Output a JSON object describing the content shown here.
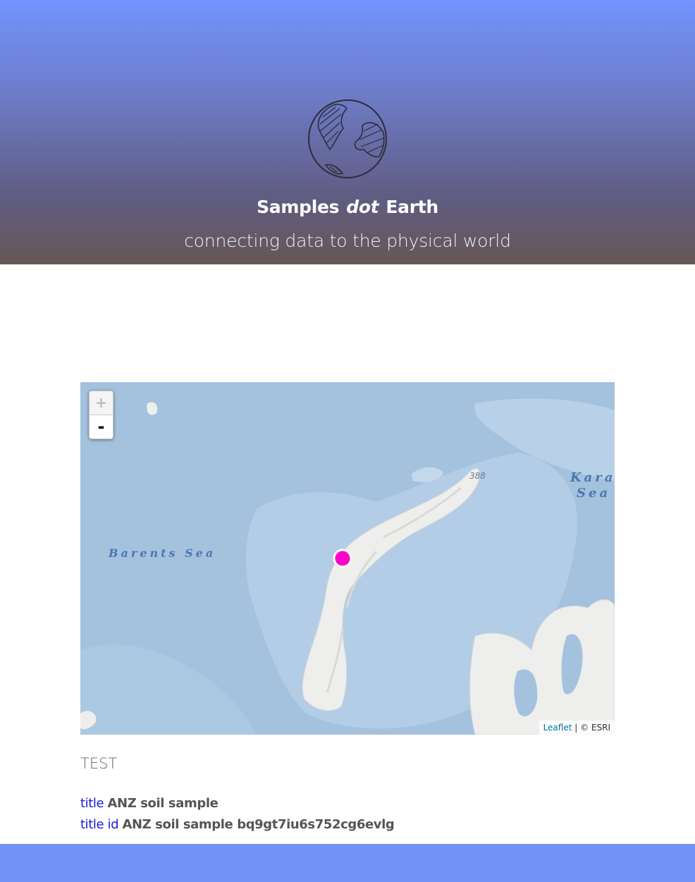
{
  "header": {
    "title_main": "Samples",
    "title_dot": "dot",
    "title_end": "Earth",
    "tagline": "connecting data to the physical world",
    "logo_icon": "globe-sketch-icon"
  },
  "map": {
    "zoom_in_label": "+",
    "zoom_out_label": "-",
    "attribution_link": "Leaflet",
    "attribution_text": "| © ESRI",
    "labels": {
      "barents_sea": "Barents Sea",
      "kara_sea_line1": "Kara",
      "kara_sea_line2": "Sea",
      "elevation": "388"
    },
    "marker_color": "#ff00c8",
    "water_color": "#a4c2de",
    "land_color": "#eeeeec"
  },
  "sample": {
    "heading": "TEST",
    "properties": [
      {
        "key": "title",
        "value": "ANZ soil sample"
      },
      {
        "key": "title id",
        "value": "ANZ soil sample bq9gt7iu6s752cg6evlg"
      }
    ]
  },
  "colors": {
    "header_top": "#7194ff",
    "header_bottom": "#665755",
    "footer": "#7193f8",
    "key_text": "#1a1add"
  }
}
